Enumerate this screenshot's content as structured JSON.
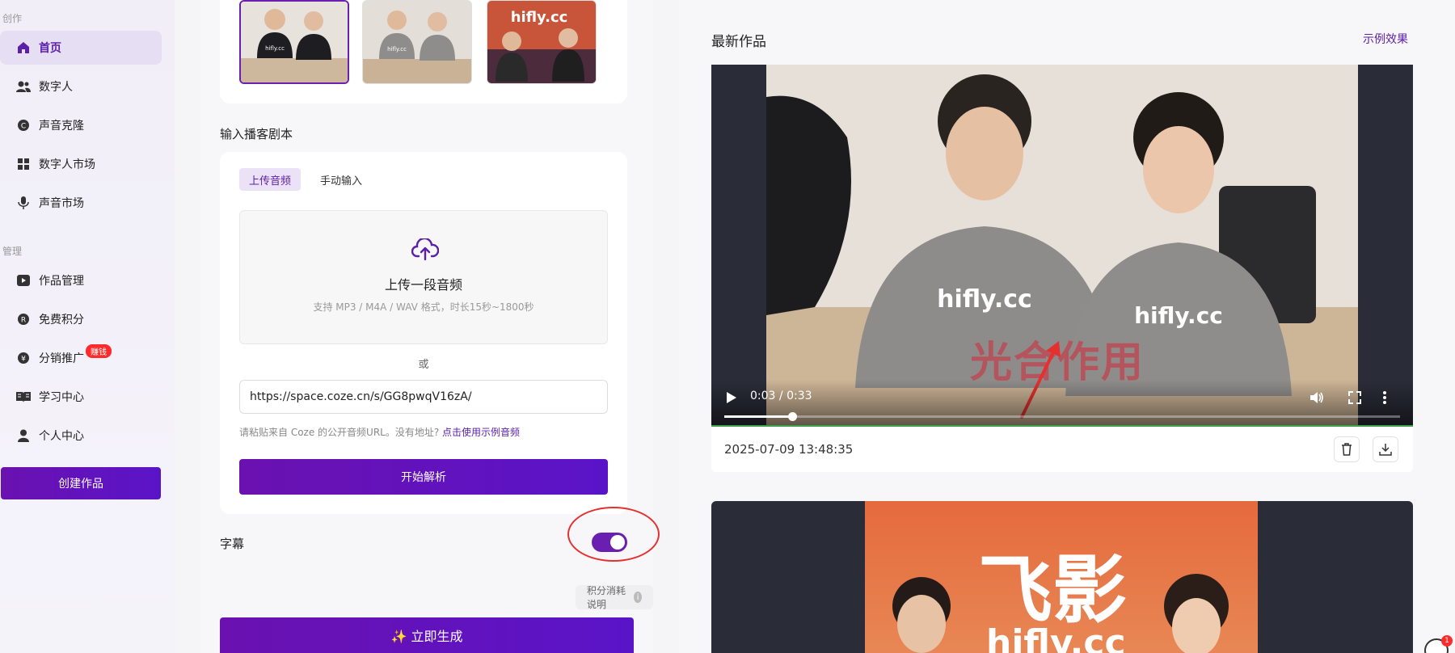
{
  "sidebar": {
    "section_create": "创作",
    "section_manage": "管理",
    "items": [
      {
        "label": "首页",
        "icon": "home-icon"
      },
      {
        "label": "数字人",
        "icon": "users-icon"
      },
      {
        "label": "声音克隆",
        "icon": "copyright-icon"
      },
      {
        "label": "数字人市场",
        "icon": "grid-icon"
      },
      {
        "label": "声音市场",
        "icon": "microphone-icon"
      },
      {
        "label": "作品管理",
        "icon": "video-icon"
      },
      {
        "label": "免费积分",
        "icon": "registered-icon"
      },
      {
        "label": "分销推广",
        "icon": "yen-icon",
        "badge": "赚钱"
      },
      {
        "label": "学习中心",
        "icon": "book-icon"
      },
      {
        "label": "个人中心",
        "icon": "user-icon"
      }
    ],
    "create_button": "创建作品",
    "accent_color": "#6a1fb0"
  },
  "thumbnails": [
    {
      "caption": "hifly.cc"
    },
    {
      "caption": "hifly.cc"
    },
    {
      "caption": "hifly.cc"
    }
  ],
  "script": {
    "title": "输入播客剧本",
    "tabs": [
      "上传音频",
      "手动输入"
    ],
    "upload_title": "上传一段音频",
    "upload_hint": "支持 MP3 / M4A / WAV 格式，时长15秒~1800秒",
    "or_text": "或",
    "url_value": "https://space.coze.cn/s/GG8pwqV16zA/",
    "url_hint": "请粘贴来自 Coze 的公开音频URL。没有地址?",
    "url_hint_link": "点击使用示例音频",
    "parse_button": "开始解析"
  },
  "subtitle": {
    "label": "字幕",
    "enabled": true
  },
  "points_info": "积分消耗说明",
  "generate_button": "✨ 立即生成",
  "works": {
    "title": "最新作品",
    "example_link": "示例效果",
    "items": [
      {
        "time_current": "0:03",
        "time_separator": "/",
        "time_total": "0:33",
        "progress": 0.1,
        "overlay_text": "光合作用",
        "shirt_text": "hifly.cc",
        "date": "2025-07-09 13:48:35"
      },
      {
        "brand_text": "飞影",
        "brand_sub": "hifly.cc"
      }
    ]
  },
  "help_badge": "1"
}
